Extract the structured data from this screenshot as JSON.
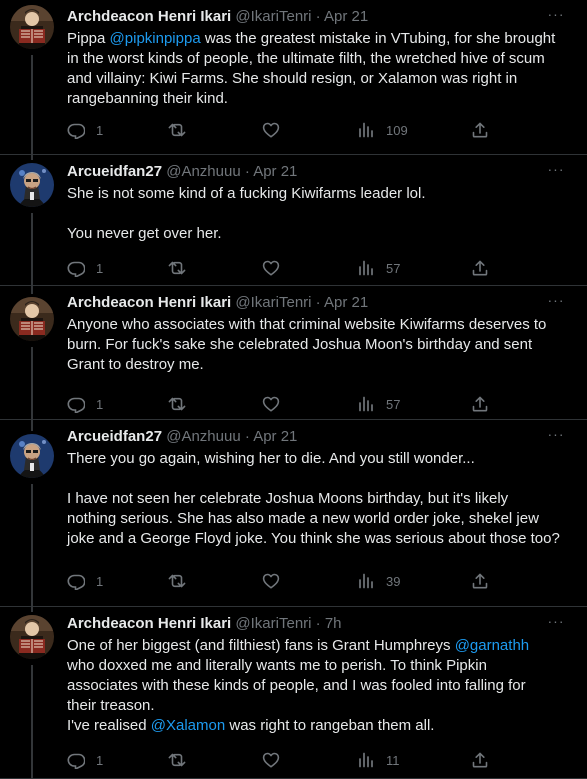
{
  "colors": {
    "background": "#000000",
    "text": "#e7e9ea",
    "muted": "#71767b",
    "link": "#1d9bf0",
    "divider": "#2f3336"
  },
  "icons": {
    "reply": "reply-icon",
    "retweet": "retweet-icon",
    "like": "heart-icon",
    "views": "views-icon",
    "share": "share-icon",
    "more": "more-icon"
  },
  "tweets": [
    {
      "name": "Archdeacon Henri Ikari",
      "handle": "@IkariTenri",
      "dot": "·",
      "time": "Apr 21",
      "more": "···",
      "lines": [
        [
          {
            "t": "Pippa "
          },
          {
            "t": "@pipkinpippa",
            "m": true
          },
          {
            "t": " was the greatest mistake in VTubing, for she brought"
          }
        ],
        [
          {
            "t": "in the worst kinds of people, the ultimate filth, the wretched hive of scum"
          }
        ],
        [
          {
            "t": "and villainy: Kiwi Farms. She should resign, or Xalamon was right in"
          }
        ],
        [
          {
            "t": "rangebanning their kind."
          }
        ]
      ],
      "replies": "1",
      "retweets": "",
      "likes": "",
      "views": "109"
    },
    {
      "name": "Arcueidfan27",
      "handle": "@Anzhuuu",
      "dot": "·",
      "time": "Apr 21",
      "more": "···",
      "lines": [
        [
          {
            "t": "She is not some kind of a fucking Kiwifarms leader lol."
          }
        ],
        [],
        [
          {
            "t": "You never get over her."
          }
        ]
      ],
      "replies": "1",
      "retweets": "",
      "likes": "",
      "views": "57"
    },
    {
      "name": "Archdeacon Henri Ikari",
      "handle": "@IkariTenri",
      "dot": "·",
      "time": "Apr 21",
      "more": "···",
      "lines": [
        [
          {
            "t": "Anyone who associates with that criminal website Kiwifarms deserves to"
          }
        ],
        [
          {
            "t": "burn. For fuck's sake she celebrated Joshua Moon's birthday and sent"
          }
        ],
        [
          {
            "t": "Grant to destroy me."
          }
        ]
      ],
      "replies": "1",
      "retweets": "",
      "likes": "",
      "views": "57"
    },
    {
      "name": "Arcueidfan27",
      "handle": "@Anzhuuu",
      "dot": "·",
      "time": "Apr 21",
      "more": "···",
      "lines": [
        [
          {
            "t": "There you go again, wishing her to die. And you still wonder..."
          }
        ],
        [],
        [
          {
            "t": "I have not seen her celebrate Joshua Moons birthday, but it's likely"
          }
        ],
        [
          {
            "t": "nothing serious. She has also made a new world order joke, shekel jew"
          }
        ],
        [
          {
            "t": "joke and a George Floyd joke. You think she was serious about those too?"
          }
        ]
      ],
      "replies": "1",
      "retweets": "",
      "likes": "",
      "views": "39"
    },
    {
      "name": "Archdeacon Henri Ikari",
      "handle": "@IkariTenri",
      "dot": "·",
      "time": "7h",
      "more": "···",
      "lines": [
        [
          {
            "t": "One of her biggest (and filthiest) fans is Grant Humphreys "
          },
          {
            "t": "@garnathh",
            "m": true
          }
        ],
        [
          {
            "t": "who doxxed me and literally wants me to perish. To think Pipkin"
          }
        ],
        [
          {
            "t": "associates with these kinds of people, and I was fooled into falling for"
          }
        ],
        [
          {
            "t": "their treason."
          }
        ],
        [
          {
            "t": "I've realised "
          },
          {
            "t": "@Xalamon",
            "m": true
          },
          {
            "t": " was right to rangeban them all."
          }
        ]
      ],
      "replies": "1",
      "retweets": "",
      "likes": "",
      "views": "11"
    }
  ]
}
